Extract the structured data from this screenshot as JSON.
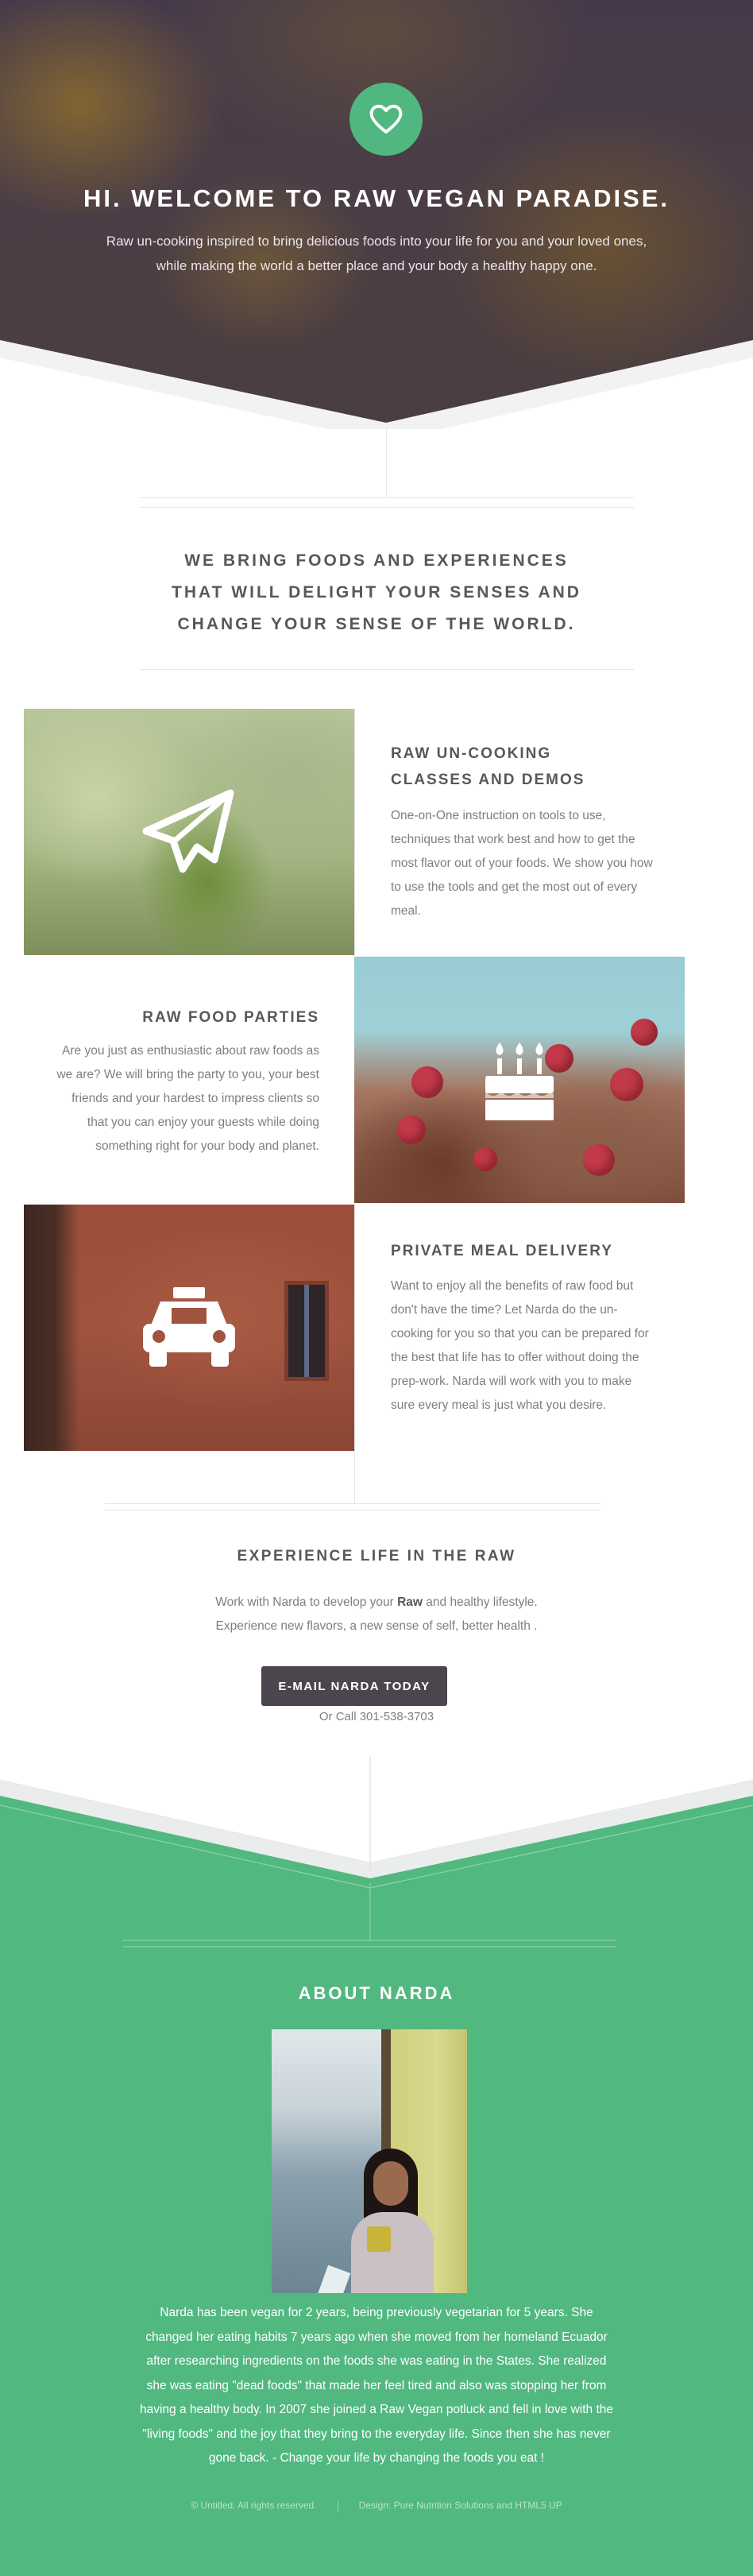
{
  "hero": {
    "icon": "heart-icon",
    "title": "HI. WELCOME TO RAW VEGAN PARADISE.",
    "lead_lines": [
      "Raw un-cooking inspired to bring delicious foods into your life for you and your loved ones,",
      "while making the world a better place and your body a healthy happy one."
    ]
  },
  "intro": {
    "title_lines": [
      "WE BRING FOODS AND EXPERIENCES",
      "THAT WILL DELIGHT YOUR SENSES AND",
      "CHANGE YOUR SENSE OF THE WORLD."
    ]
  },
  "features": [
    {
      "icon": "paper-plane-icon",
      "title_lines": [
        "RAW UN-COOKING",
        "CLASSES AND DEMOS"
      ],
      "text_lines": [
        "One-on-One instruction on tools to use,",
        "techniques that work best and how to get the",
        "most flavor out of your foods. We show you how",
        "to use the tools and get the most out of every",
        "meal."
      ]
    },
    {
      "icon": "birthday-cake-icon",
      "title_lines": [
        "RAW FOOD PARTIES"
      ],
      "text_lines": [
        "Are you just as enthusiastic about raw foods as",
        "we are? We will bring the party to you, your best",
        "friends and your hardest to impress clients so",
        "that you can enjoy your guests while doing",
        "something right for your body and planet."
      ]
    },
    {
      "icon": "taxi-icon",
      "title_lines": [
        "PRIVATE MEAL DELIVERY"
      ],
      "text_lines": [
        "Want to enjoy all the benefits of raw food but",
        "don't have the time? Let Narda do the un-",
        "cooking for you so that you can be prepared for",
        "the best that life has to offer without doing the",
        "prep-work. Narda will work with you to make",
        "sure every meal is just what you desire."
      ]
    }
  ],
  "cta": {
    "title": "EXPERIENCE LIFE IN THE RAW",
    "line1_before": "Work with Narda to develop your ",
    "line1_bold": "Raw",
    "line1_after": " and healthy lifestyle.",
    "line2": "Experience new flavors, a new sense of self, better health .",
    "button": "E-MAIL NARDA TODAY",
    "call": "Or Call 301-538-3703"
  },
  "about": {
    "title": "ABOUT NARDA",
    "text_lines": [
      "Narda has been vegan for 2 years, being previously vegetarian for 5 years. She",
      "changed her eating habits 7 years ago when she moved from her homeland Ecuador",
      "after researching ingredients on the foods she was eating in the States. She realized",
      "she was eating \"dead foods\" that made her feel tired and also was stopping her from",
      "having a healthy body. In 2007 she joined a Raw Vegan potluck and fell in love with the",
      "\"living foods\" and the joy that they bring to the everyday life. Since then she has never",
      "gone back.  - Change your life by changing the foods you eat !"
    ]
  },
  "footer": {
    "copyright": "© Untitled. All rights reserved.",
    "credit": "Design: Pure Nutrition Solutions and HTML5 UP"
  },
  "colors": {
    "accent_green": "#51b880",
    "button_dark": "#4b464d",
    "heading": "#55595c",
    "body_text": "#7c8081"
  }
}
